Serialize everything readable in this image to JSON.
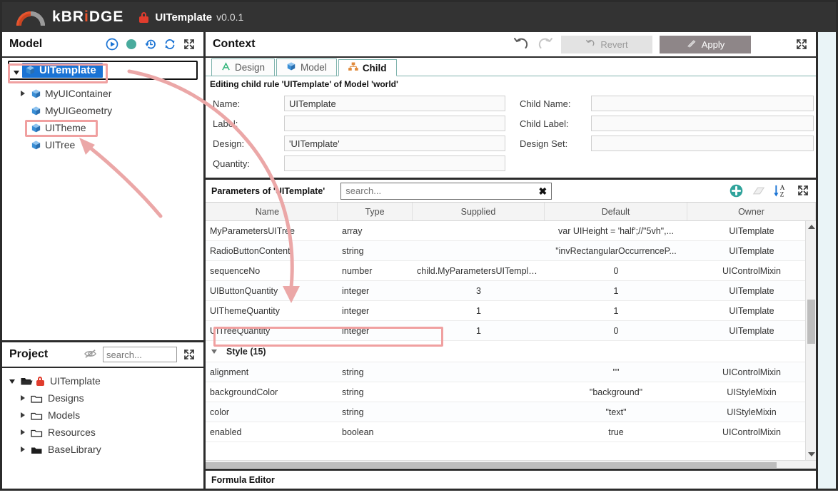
{
  "titlebar": {
    "brand_k": "k",
    "brand_br": "BR",
    "brand_i": "i",
    "brand_dge": "DGE",
    "lock_icon": "lock-icon",
    "doc_title": "UITemplate",
    "version": "v0.0.1"
  },
  "model_panel": {
    "title": "Model",
    "icons": [
      "play-circle-icon",
      "status-dot-icon",
      "history-icon",
      "refresh-icon",
      "expand-icon"
    ],
    "tree": [
      {
        "label": "UITemplate",
        "indent": 0,
        "caret": "open",
        "selected": true,
        "icon": "cube-icon"
      },
      {
        "label": "MyUIContainer",
        "indent": 1,
        "caret": "closed",
        "selected": false,
        "icon": "cube-icon"
      },
      {
        "label": "MyUIGeometry",
        "indent": 1,
        "caret": "none",
        "selected": false,
        "icon": "cube-icon"
      },
      {
        "label": "UITheme",
        "indent": 1,
        "caret": "none",
        "selected": false,
        "icon": "cube-icon"
      },
      {
        "label": "UITree",
        "indent": 1,
        "caret": "none",
        "selected": false,
        "icon": "cube-icon"
      }
    ]
  },
  "project_panel": {
    "title": "Project",
    "hide_icon": "eye-slash-icon",
    "expand_icon": "expand-icon",
    "search_placeholder": "search...",
    "search_value": "",
    "tree": [
      {
        "label": "UITemplate",
        "indent": 0,
        "caret": "open",
        "icon": "open-folder-icon",
        "locked": true
      },
      {
        "label": "Designs",
        "indent": 1,
        "caret": "closed",
        "icon": "folder-icon",
        "locked": false
      },
      {
        "label": "Models",
        "indent": 1,
        "caret": "closed",
        "icon": "folder-icon",
        "locked": false
      },
      {
        "label": "Resources",
        "indent": 1,
        "caret": "closed",
        "icon": "folder-icon",
        "locked": false
      },
      {
        "label": "BaseLibrary",
        "indent": 1,
        "caret": "closed",
        "icon": "folder-filled-icon",
        "locked": false
      }
    ]
  },
  "context": {
    "title": "Context",
    "undo_icon": "undo-icon",
    "redo_icon": "redo-icon",
    "revert_label": "Revert",
    "apply_label": "Apply",
    "expand_icon": "expand-icon",
    "tabs": [
      {
        "label": "Design",
        "icon": "letter-a-icon",
        "active": false
      },
      {
        "label": "Model",
        "icon": "cube-icon",
        "active": false
      },
      {
        "label": "Child",
        "icon": "hierarchy-icon",
        "active": true
      }
    ],
    "editing_line": "Editing child rule 'UITemplate' of Model 'world'",
    "fields_left": [
      {
        "label": "Name:",
        "value": "UITemplate"
      },
      {
        "label": "Label:",
        "value": ""
      },
      {
        "label": "Design:",
        "value": "'UITemplate'"
      },
      {
        "label": "Quantity:",
        "value": ""
      }
    ],
    "fields_right": [
      {
        "label": "Child Name:",
        "value": ""
      },
      {
        "label": "Child Label:",
        "value": ""
      },
      {
        "label": "Design Set:",
        "value": ""
      }
    ]
  },
  "parameters": {
    "title": "Parameters of 'UITemplate'",
    "search_placeholder": "search...",
    "search_value": "",
    "clear_label": "✖",
    "icons": [
      "add-icon",
      "eraser-icon",
      "sort-az-icon",
      "expand-icon"
    ],
    "columns": [
      {
        "label": "Name",
        "sort": "↑"
      },
      {
        "label": "Type",
        "sort": ""
      },
      {
        "label": "Supplied",
        "sort": ""
      },
      {
        "label": "Default",
        "sort": ""
      },
      {
        "label": "Owner",
        "sort": ""
      }
    ],
    "rows": [
      {
        "kind": "row",
        "name": "MyParametersUITree",
        "type": "array",
        "supplied": "",
        "default": "var UIHeight = 'half';//\"5vh\",...",
        "owner": "UITemplate",
        "highlight": false
      },
      {
        "kind": "row",
        "name": "RadioButtonContent",
        "type": "string",
        "supplied": "",
        "default": "\"invRectangularOccurrenceP...",
        "owner": "UITemplate",
        "highlight": false
      },
      {
        "kind": "row",
        "name": "sequenceNo",
        "type": "number",
        "supplied": "child.MyParametersUITempla...",
        "default": "0",
        "owner": "UIControlMixin",
        "highlight": false
      },
      {
        "kind": "row",
        "name": "UIButtonQuantity",
        "type": "integer",
        "supplied": "3",
        "default": "1",
        "owner": "UITemplate",
        "highlight": false
      },
      {
        "kind": "row",
        "name": "UIThemeQuantity",
        "type": "integer",
        "supplied": "1",
        "default": "1",
        "owner": "UITemplate",
        "highlight": true
      },
      {
        "kind": "row",
        "name": "UITreeQuantity",
        "type": "integer",
        "supplied": "1",
        "default": "0",
        "owner": "UITemplate",
        "highlight": false
      },
      {
        "kind": "group",
        "name": "Style (15)",
        "caret": "open"
      },
      {
        "kind": "row",
        "name": "alignment",
        "type": "string",
        "supplied": "",
        "default": "\"\"",
        "owner": "UIControlMixin",
        "highlight": false
      },
      {
        "kind": "row",
        "name": "backgroundColor",
        "type": "string",
        "supplied": "",
        "default": "\"background\"",
        "owner": "UIStyleMixin",
        "highlight": false
      },
      {
        "kind": "row",
        "name": "color",
        "type": "string",
        "supplied": "",
        "default": "\"text\"",
        "owner": "UIStyleMixin",
        "highlight": false
      },
      {
        "kind": "row",
        "name": "enabled",
        "type": "boolean",
        "supplied": "",
        "default": "true",
        "owner": "UIControlMixin",
        "highlight": false
      }
    ]
  },
  "formula_editor": {
    "title": "Formula Editor"
  },
  "colors": {
    "titlebar_bg": "#333333",
    "accent_orange": "#e8532c",
    "lock_red": "#e03c2d",
    "selection_blue": "#1a73d4",
    "teal": "#2fa39b",
    "annotation_red": "#f0a0a0",
    "apply_gray": "#8e8688",
    "right_strip": "#eaf4f7"
  }
}
